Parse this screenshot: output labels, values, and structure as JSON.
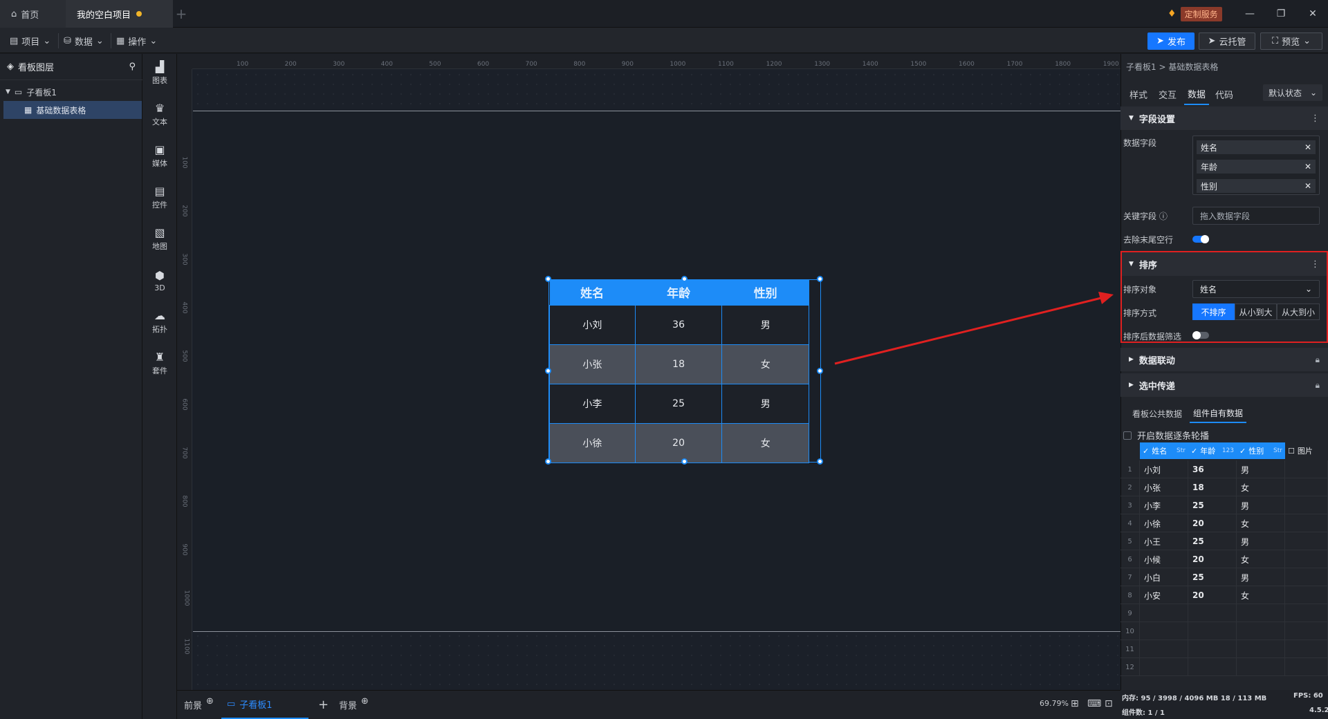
{
  "titlebar": {
    "home_tab": "首页",
    "project_tab": "我的空白项目",
    "custom_service": "定制服务"
  },
  "menubar": {
    "project": "项目",
    "data": "数据",
    "operate": "操作",
    "publish": "发布",
    "cloud": "云托管",
    "preview": "预览"
  },
  "layers": {
    "title": "看板图层",
    "items": [
      {
        "label": "子看板1"
      },
      {
        "label": "基础数据表格"
      }
    ]
  },
  "rail": [
    {
      "label": "图表",
      "icon": "chart-icon",
      "glyph": "▟"
    },
    {
      "label": "文本",
      "icon": "text-icon",
      "glyph": "♛"
    },
    {
      "label": "媒体",
      "icon": "media-icon",
      "glyph": "▣"
    },
    {
      "label": "控件",
      "icon": "widget-icon",
      "glyph": "▤"
    },
    {
      "label": "地图",
      "icon": "map-icon",
      "glyph": "▧"
    },
    {
      "label": "3D",
      "icon": "cube-icon",
      "glyph": "⬢"
    },
    {
      "label": "拓扑",
      "icon": "topology-icon",
      "glyph": "☁"
    },
    {
      "label": "套件",
      "icon": "kit-icon",
      "glyph": "♜"
    }
  ],
  "ruler": {
    "top": [
      "100",
      "200",
      "300",
      "400",
      "500",
      "600",
      "700",
      "800",
      "900",
      "1000",
      "1100",
      "1200",
      "1300",
      "1400",
      "1500",
      "1600",
      "1700",
      "1800",
      "1900"
    ],
    "left": [
      "100",
      "200",
      "300",
      "400",
      "500",
      "600",
      "700",
      "800",
      "900",
      "1000",
      "1100"
    ]
  },
  "widget_table": {
    "headers": [
      "姓名",
      "年龄",
      "性别"
    ],
    "rows": [
      [
        "小刘",
        "36",
        "男"
      ],
      [
        "小张",
        "18",
        "女"
      ],
      [
        "小李",
        "25",
        "男"
      ],
      [
        "小徐",
        "20",
        "女"
      ]
    ]
  },
  "bottombar": {
    "foreground": "前景",
    "board_tab": "子看板1",
    "background": "背景",
    "zoom": "69.79%"
  },
  "panel": {
    "breadcrumb": "子看板1 > 基础数据表格",
    "tabs": [
      "样式",
      "交互",
      "数据",
      "代码"
    ],
    "active_tab": "数据",
    "state": "默认状态",
    "field_settings": "字段设置",
    "data_fields_label": "数据字段",
    "data_fields": [
      "姓名",
      "年龄",
      "性别"
    ],
    "key_field_label": "关键字段",
    "key_field_placeholder": "拖入数据字段",
    "trim_tail_label": "去除末尾空行",
    "sort_title": "排序",
    "sort_target_label": "排序对象",
    "sort_target_value": "姓名",
    "sort_mode_label": "排序方式",
    "sort_modes": [
      "不排序",
      "从小到大",
      "从大到小"
    ],
    "sort_filter_label": "排序后数据筛选",
    "linkage": "数据联动",
    "selected_pass": "选中传递",
    "data_tabs": [
      "看板公共数据",
      "组件自有数据"
    ],
    "carousel_label": "开启数据逐条轮播",
    "grid_columns": [
      {
        "name": "姓名",
        "type": "Str"
      },
      {
        "name": "年龄",
        "type": "123"
      },
      {
        "name": "性别",
        "type": "Str"
      },
      {
        "name": "图片",
        "type": ""
      }
    ],
    "grid_rows": [
      {
        "n": "1",
        "cells": [
          "小刘",
          "36",
          "男"
        ]
      },
      {
        "n": "2",
        "cells": [
          "小张",
          "18",
          "女"
        ]
      },
      {
        "n": "3",
        "cells": [
          "小李",
          "25",
          "男"
        ]
      },
      {
        "n": "4",
        "cells": [
          "小徐",
          "20",
          "女"
        ]
      },
      {
        "n": "5",
        "cells": [
          "小王",
          "25",
          "男"
        ]
      },
      {
        "n": "6",
        "cells": [
          "小候",
          "20",
          "女"
        ]
      },
      {
        "n": "7",
        "cells": [
          "小白",
          "25",
          "男"
        ]
      },
      {
        "n": "8",
        "cells": [
          "小安",
          "20",
          "女"
        ]
      },
      {
        "n": "9",
        "cells": [
          "",
          "",
          ""
        ]
      },
      {
        "n": "10",
        "cells": [
          "",
          "",
          ""
        ]
      },
      {
        "n": "11",
        "cells": [
          "",
          "",
          ""
        ]
      },
      {
        "n": "12",
        "cells": [
          "",
          "",
          ""
        ]
      }
    ]
  },
  "status": {
    "memory": "内存: 95 / 3998 / 4096 MB 18 / 113 MB",
    "fps": "FPS: 60",
    "count": "组件数: 1 / 1",
    "version": "4.5.2"
  },
  "colors": {
    "accent": "#1677ff",
    "table_header": "#1d8cf8",
    "annotation": "#e02020"
  }
}
